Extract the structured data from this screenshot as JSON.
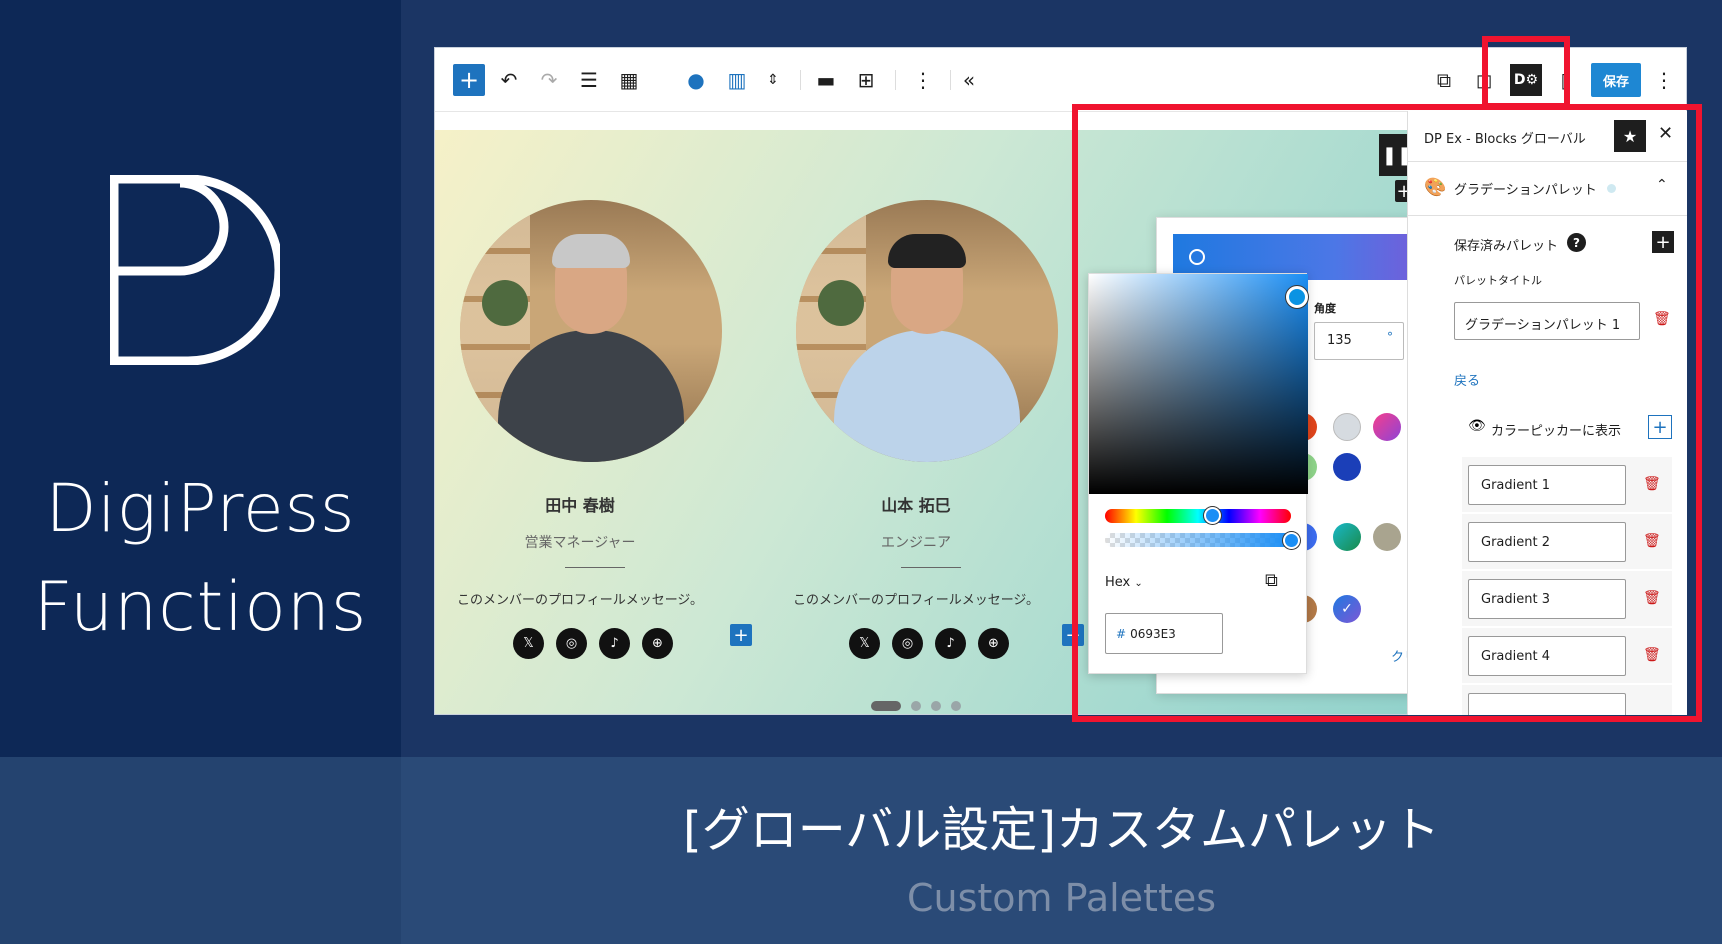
{
  "brand": {
    "line1": "DigiPress",
    "line2": "Functions"
  },
  "caption": {
    "title": "[グローバル設定]カスタムパレット",
    "subtitle": "Custom Palettes"
  },
  "toolbar": {
    "save_label": "保存"
  },
  "members": [
    {
      "name": "田中 春樹",
      "role": "営業マネージャー",
      "message": "このメンバーのプロフィールメッセージ。"
    },
    {
      "name": "山本 拓巳",
      "role": "エンジニア",
      "message": "このメンバーのプロフィールメッセージ。"
    }
  ],
  "social_icons": [
    "x-icon",
    "instagram-icon",
    "tiktok-icon",
    "globe-icon"
  ],
  "gradient_popover": {
    "angle_label": "角度",
    "angle_value": "135",
    "angle_unit": "°",
    "clear_label": "クリア"
  },
  "color_picker": {
    "mode_label": "Hex",
    "hex_value": "0693E3"
  },
  "sidebar": {
    "title": "DP Ex - Blocks グローバル",
    "section_label": "グラデーションパレット",
    "saved_label": "保存済みパレット",
    "help_symbol": "?",
    "palette_title_label": "パレットタイトル",
    "palette_title_value": "グラデーションパレット 1",
    "back_label": "戻る",
    "show_in_picker_label": "カラーピッカーに表示",
    "gradients": [
      "Gradient 1",
      "Gradient 2",
      "Gradient 3",
      "Gradient 4"
    ]
  },
  "colors": {
    "accent": "#1e73be",
    "highlight": "#f0142f",
    "brand_bg": "#0d2856"
  }
}
